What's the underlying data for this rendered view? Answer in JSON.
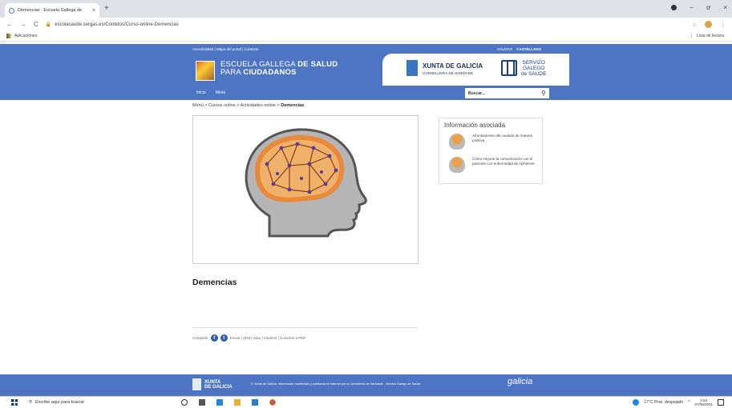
{
  "browser": {
    "tab_title": "Demencias - Escuela Gallega de",
    "tab_close": "×",
    "new_tab": "+",
    "url": "escolasaude.sergas.es/Contidos/Curso-online-Demencias",
    "bookmarks_apps": "Aplicaciones",
    "reading_list": "Lista de lectura",
    "back": "←",
    "forward": "→",
    "reload": "C",
    "star": "☆",
    "menu": "⋮",
    "minimize": "−",
    "maximize": "ơ",
    "close": "×"
  },
  "header": {
    "top_links": "Accesibilidad | Mapa del portal | Contacto",
    "lang_galego": "GALEGO",
    "lang_castellano": "CASTELLANO",
    "school_line1_a": "ESCUELA GALLEGA ",
    "school_line1_b": "DE SALUD",
    "school_line2_a": "PARA ",
    "school_line2_b": "CIUDADANOS",
    "xunta_name": "XUNTA DE GALICIA",
    "xunta_dept": "CONSELLERÍA DE SANIDADE",
    "sergas_1": "SERVIZO",
    "sergas_2": "GALEGO",
    "sergas_3": "de SAÚDE",
    "menu_inicio": "Inicio",
    "menu_menu": "Menú",
    "search_placeholder": "Buscar..."
  },
  "content": {
    "breadcrumb_path": "Menú > Cursos online > Actividades online > ",
    "breadcrumb_current": "Demencias",
    "title": "Demencias",
    "share_label": "Compartir",
    "share_rest": "Enviar | (543) Votar | Imprimir | Convertir a PDF"
  },
  "sidebar": {
    "title": "Información asociada",
    "items": [
      {
        "text": "Afrontamiento del cuidado de manera positiva"
      },
      {
        "text": "Cómo mejorar la comunicación con el paciente con enfermedad de Alzheimer"
      }
    ]
  },
  "footer": {
    "xunta_1": "XUNTA",
    "xunta_2": "DE GALICIA",
    "legal": "© Xunta de Galicia. Información mantenida y publicada en internet por la Consellería de Sanidade - Servizo Galego de Saúde",
    "galicia": "galicia"
  },
  "taskbar": {
    "search": "Escribe aquí para buscar",
    "weather": "17°C Prac. despejado",
    "time": "1:54",
    "date": "07/08/2021"
  },
  "colors": {
    "header_blue": "#4e74c4",
    "brain_orange": "#e9893a",
    "head_gray": "#b5b5b5"
  }
}
